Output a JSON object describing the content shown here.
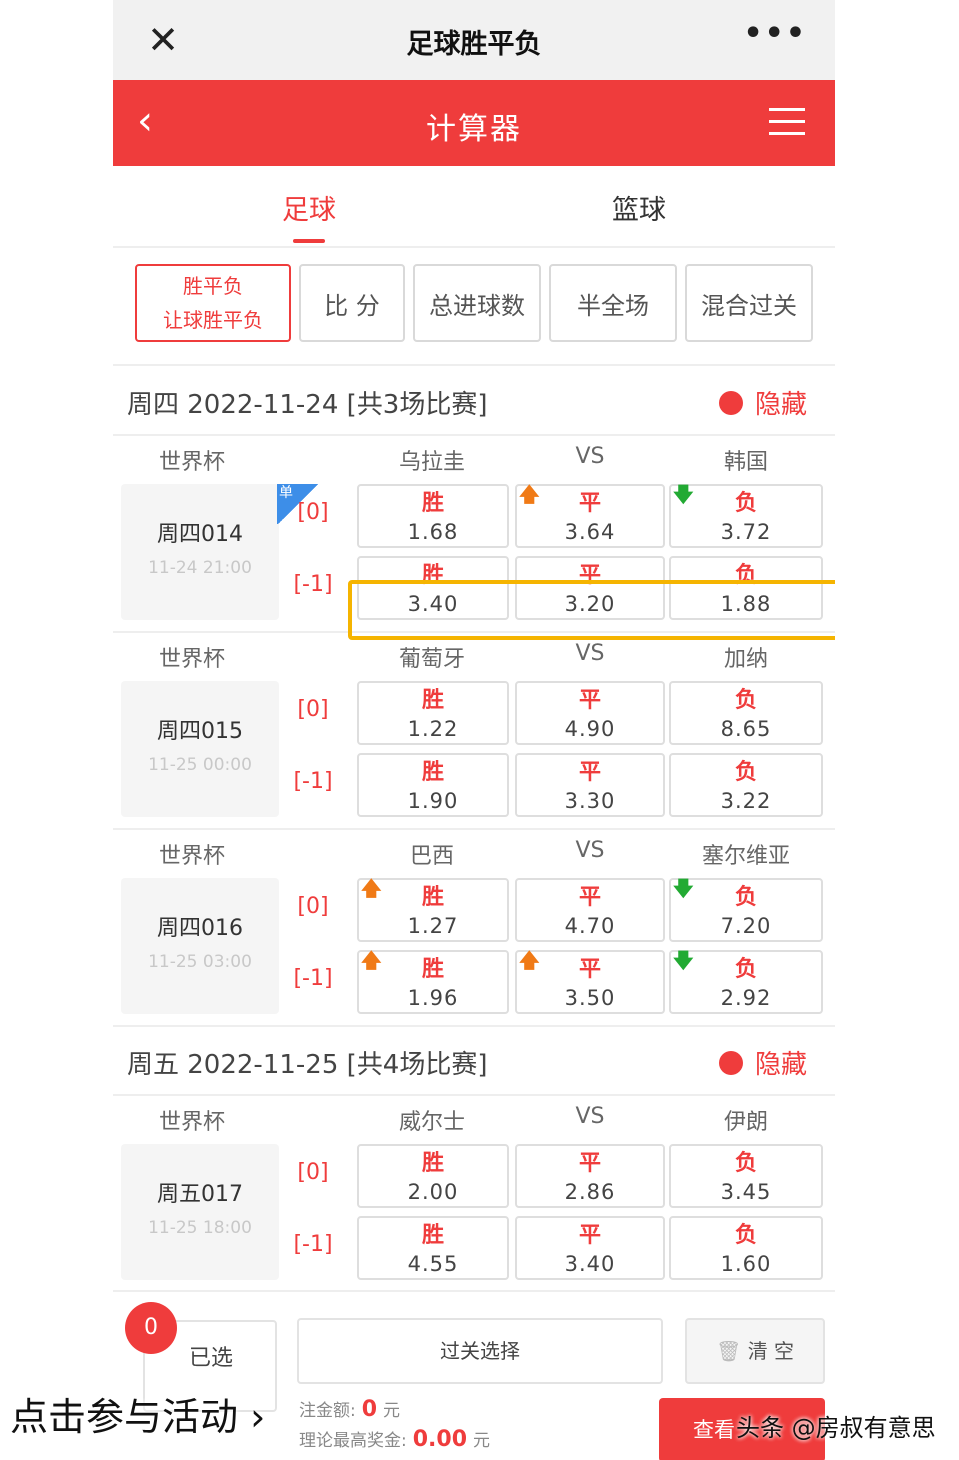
{
  "titlebar": {
    "close_glyph": "✕",
    "title": "足球胜平负",
    "more_glyph": "•••"
  },
  "redbar": {
    "back_glyph": "‹",
    "title": "计算器"
  },
  "sport_tabs": [
    {
      "label": "足球",
      "active": true
    },
    {
      "label": "篮球",
      "active": false
    }
  ],
  "play_types": {
    "active_line1": "胜平负",
    "active_line2": "让球胜平负",
    "others": [
      "比 分",
      "总进球数",
      "半全场",
      "混合过关"
    ]
  },
  "days": [
    {
      "label": "周四 2022-11-24 [共3场比赛]",
      "hide": "隐藏",
      "matches": [
        {
          "league": "世界杯",
          "home": "乌拉圭",
          "vs": "VS",
          "away": "韩国",
          "code": "周四014",
          "time": "11-24 21:00",
          "badge": "单",
          "rows": [
            {
              "hcap": "[0]",
              "cells": [
                {
                  "res": "胜",
                  "val": "1.68",
                  "arrow": ""
                },
                {
                  "res": "平",
                  "val": "3.64",
                  "arrow": "up"
                },
                {
                  "res": "负",
                  "val": "3.72",
                  "arrow": "down"
                }
              ]
            },
            {
              "hcap": "[-1]",
              "cells": [
                {
                  "res": "胜",
                  "val": "3.40",
                  "arrow": ""
                },
                {
                  "res": "平",
                  "val": "3.20",
                  "arrow": ""
                },
                {
                  "res": "负",
                  "val": "1.88",
                  "arrow": ""
                }
              ]
            }
          ]
        },
        {
          "league": "世界杯",
          "home": "葡萄牙",
          "vs": "VS",
          "away": "加纳",
          "code": "周四015",
          "time": "11-25 00:00",
          "badge": "",
          "rows": [
            {
              "hcap": "[0]",
              "cells": [
                {
                  "res": "胜",
                  "val": "1.22",
                  "arrow": ""
                },
                {
                  "res": "平",
                  "val": "4.90",
                  "arrow": ""
                },
                {
                  "res": "负",
                  "val": "8.65",
                  "arrow": ""
                }
              ]
            },
            {
              "hcap": "[-1]",
              "cells": [
                {
                  "res": "胜",
                  "val": "1.90",
                  "arrow": ""
                },
                {
                  "res": "平",
                  "val": "3.30",
                  "arrow": ""
                },
                {
                  "res": "负",
                  "val": "3.22",
                  "arrow": ""
                }
              ]
            }
          ]
        },
        {
          "league": "世界杯",
          "home": "巴西",
          "vs": "VS",
          "away": "塞尔维亚",
          "code": "周四016",
          "time": "11-25 03:00",
          "badge": "",
          "rows": [
            {
              "hcap": "[0]",
              "cells": [
                {
                  "res": "胜",
                  "val": "1.27",
                  "arrow": "up"
                },
                {
                  "res": "平",
                  "val": "4.70",
                  "arrow": ""
                },
                {
                  "res": "负",
                  "val": "7.20",
                  "arrow": "down"
                }
              ]
            },
            {
              "hcap": "[-1]",
              "cells": [
                {
                  "res": "胜",
                  "val": "1.96",
                  "arrow": "up"
                },
                {
                  "res": "平",
                  "val": "3.50",
                  "arrow": "up"
                },
                {
                  "res": "负",
                  "val": "2.92",
                  "arrow": "down"
                }
              ]
            }
          ]
        }
      ]
    },
    {
      "label": "周五 2022-11-25 [共4场比赛]",
      "hide": "隐藏",
      "matches": [
        {
          "league": "世界杯",
          "home": "威尔士",
          "vs": "VS",
          "away": "伊朗",
          "code": "周五017",
          "time": "11-25 18:00",
          "badge": "",
          "rows": [
            {
              "hcap": "[0]",
              "cells": [
                {
                  "res": "胜",
                  "val": "2.00",
                  "arrow": ""
                },
                {
                  "res": "平",
                  "val": "2.86",
                  "arrow": ""
                },
                {
                  "res": "负",
                  "val": "3.45",
                  "arrow": ""
                }
              ]
            },
            {
              "hcap": "[-1]",
              "cells": [
                {
                  "res": "胜",
                  "val": "4.55",
                  "arrow": ""
                },
                {
                  "res": "平",
                  "val": "3.40",
                  "arrow": ""
                },
                {
                  "res": "负",
                  "val": "1.60",
                  "arrow": ""
                }
              ]
            }
          ]
        }
      ]
    }
  ],
  "bottom": {
    "count": "0",
    "selected_label": "已选",
    "pass_select": "过关选择",
    "clear": "清 空",
    "bet_label": "注金额:",
    "bet_value": "0",
    "bet_unit": "元",
    "prize_label": "理论最高奖金:",
    "prize_value": "0.00",
    "prize_unit": "元",
    "view_label": "查看"
  },
  "promo": "点击参与活动 ›",
  "watermark": "头条 @房叔有意思",
  "colors": {
    "accent": "#ef3c3c",
    "highlight": "#f5b400",
    "up_arrow": "#f07a16",
    "down_arrow": "#22aa33",
    "badge": "#3d8ee8"
  }
}
